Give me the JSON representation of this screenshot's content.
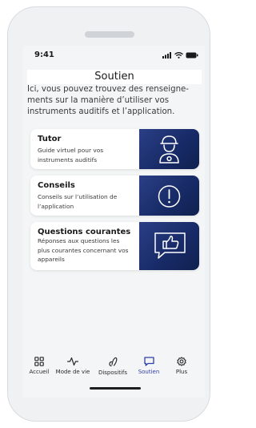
{
  "status": {
    "time": "9:41"
  },
  "page": {
    "title": "Soutien",
    "intro": "Ici, vous pouvez trouvez des renseigne-ments sur la manière d’utiliser vos instruments auditifs et l’application."
  },
  "cards": [
    {
      "title": "Tutor",
      "description": "Guide virtuel pour vos instruments auditifs",
      "icon": "tutor-person-icon"
    },
    {
      "title": "Conseils",
      "description": "Conseils sur l’utilisation de l’application",
      "icon": "exclamation-circle-icon"
    },
    {
      "title": "Questions courantes",
      "description": "Réponses aux questions les plus courantes concernant vos appareils",
      "icon": "thumbs-up-chat-icon"
    }
  ],
  "tabs": [
    {
      "label": "Accueil",
      "icon": "grid-icon"
    },
    {
      "label": "Mode de vie",
      "icon": "activity-icon"
    },
    {
      "label": "Dispositifs",
      "icon": "hearing-aid-icon"
    },
    {
      "label": "Soutien",
      "icon": "chat-bubble-icon",
      "active": true
    },
    {
      "label": "Plus",
      "icon": "gear-icon"
    }
  ],
  "colors": {
    "accent": "#2f3ea8",
    "card_image": "#1b2d6b"
  }
}
